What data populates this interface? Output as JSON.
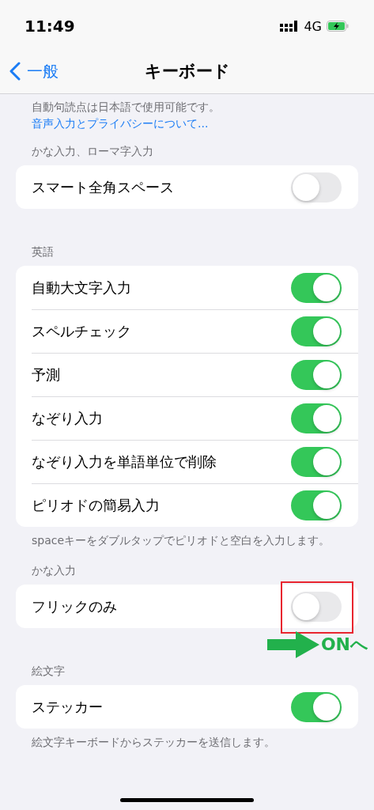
{
  "status_bar": {
    "time": "11:49",
    "network": "4G"
  },
  "nav": {
    "back": "一般",
    "title": "キーボード"
  },
  "intro": {
    "text": "自動句読点は日本語で使用可能です。",
    "link": "音声入力とプライバシーについて..."
  },
  "sections": [
    {
      "header": "かな入力、ローマ字入力",
      "rows": [
        {
          "label": "スマート全角スペース",
          "on": false,
          "highlighted": false
        }
      ]
    },
    {
      "header": "英語",
      "rows": [
        {
          "label": "自動大文字入力",
          "on": true,
          "highlighted": false
        },
        {
          "label": "スペルチェック",
          "on": true,
          "highlighted": false
        },
        {
          "label": "予測",
          "on": true,
          "highlighted": false
        },
        {
          "label": "なぞり入力",
          "on": true,
          "highlighted": false
        },
        {
          "label": "なぞり入力を単語単位で削除",
          "on": true,
          "highlighted": false
        },
        {
          "label": "ピリオドの簡易入力",
          "on": true,
          "highlighted": false
        }
      ],
      "footer": "spaceキーをダブルタップでピリオドと空白を入力します。"
    },
    {
      "header": "かな入力",
      "rows": [
        {
          "label": "フリックのみ",
          "on": false,
          "highlighted": true
        }
      ],
      "annotation": {
        "label": "ONへ"
      }
    },
    {
      "header": "絵文字",
      "rows": [
        {
          "label": "ステッカー",
          "on": true,
          "highlighted": false
        }
      ],
      "footer": "絵文字キーボードからステッカーを送信します。"
    }
  ]
}
